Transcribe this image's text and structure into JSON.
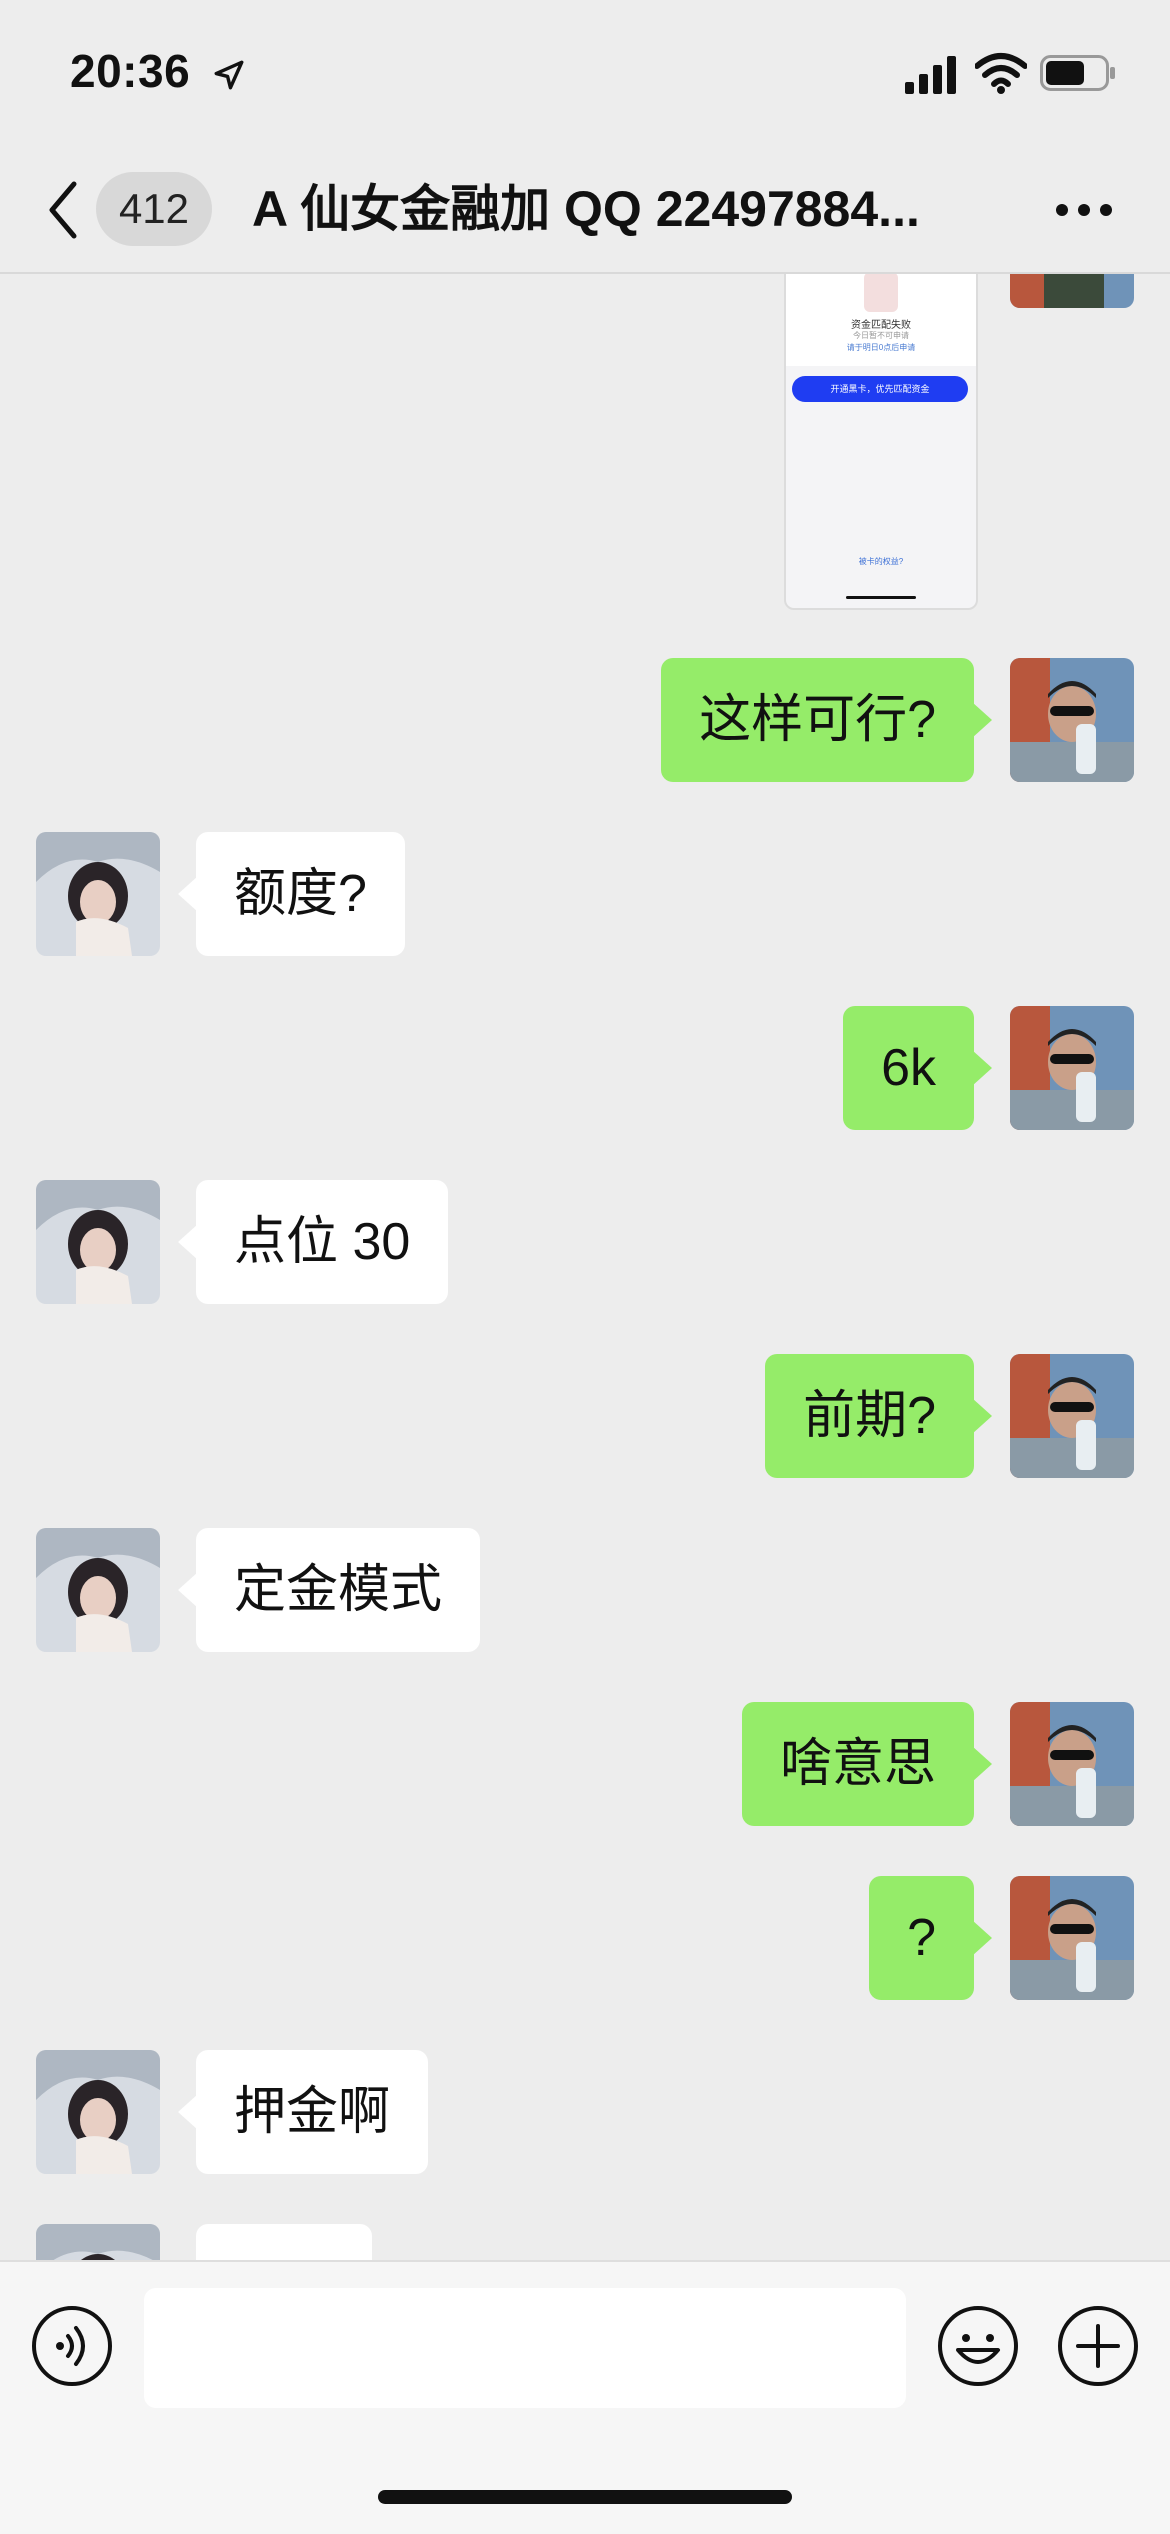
{
  "status_bar": {
    "time": "20:36",
    "icons": [
      "location-arrow-icon",
      "cellular-signal-icon",
      "wifi-icon",
      "battery-icon"
    ]
  },
  "header": {
    "back_icon": "chevron-left-icon",
    "unread_count": "412",
    "title": "A  仙女金融加 QQ 22497884...",
    "more_icon": "ellipsis-icon"
  },
  "image_message": {
    "fail_text": "资金匹配失败",
    "sub_text": "今日暂不可申请",
    "retry_text": "请于明日0点后申请",
    "button_text": "开通黑卡，优先匹配资金",
    "footer_text": "被卡的权益?"
  },
  "messages": [
    {
      "sender": "me",
      "text": "这样可行?"
    },
    {
      "sender": "them",
      "text": "额度?"
    },
    {
      "sender": "me",
      "text": "6k"
    },
    {
      "sender": "them",
      "text": "点位 30"
    },
    {
      "sender": "me",
      "text": "前期?"
    },
    {
      "sender": "them",
      "text": "定金模式"
    },
    {
      "sender": "me",
      "text": "啥意思"
    },
    {
      "sender": "me",
      "text": "?"
    },
    {
      "sender": "them",
      "text": "押金啊"
    },
    {
      "sender": "them",
      "text": ""
    }
  ],
  "input_bar": {
    "value": "",
    "placeholder": "",
    "icons": [
      "voice-icon",
      "emoji-icon",
      "plus-icon"
    ]
  },
  "colors": {
    "background": "#ededed",
    "bubble_me": "#95ec69",
    "bubble_them": "#ffffff"
  }
}
